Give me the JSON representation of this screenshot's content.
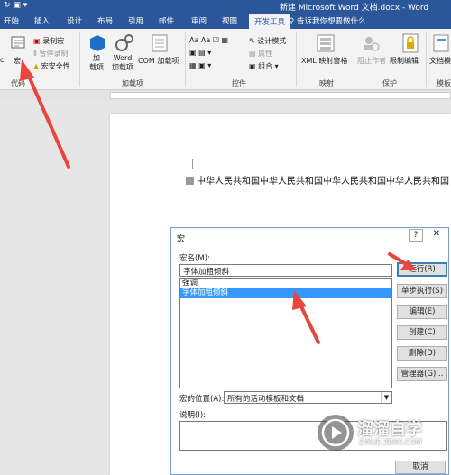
{
  "app": {
    "title": "新建 Microsoft Word 文档.docx - Word",
    "qat": "↻  ▣  ▾"
  },
  "tabs": [
    "开始",
    "插入",
    "设计",
    "布局",
    "引用",
    "邮件",
    "审阅",
    "视图",
    "开发工具"
  ],
  "tell_me": "告诉我你想要做什么",
  "ribbon": {
    "code": {
      "label": "代码",
      "vb_cut": "c",
      "macros": "宏",
      "record_macro": "录制宏",
      "pause_recording": "暂停录制",
      "macro_security": "宏安全性"
    },
    "addins": {
      "label": "加载项",
      "addins": "加\n载项",
      "word_addins": "Word\n加载项",
      "com_addins": "COM 加载项"
    },
    "controls": {
      "label": "控件",
      "design_mode": "设计模式",
      "properties": "属性",
      "group": "组合 ▾"
    },
    "mapping": {
      "label": "映射",
      "xml_pane": "XML 映射窗格"
    },
    "protect": {
      "label": "保护",
      "block_authors": "阻止作者",
      "restrict_editing": "限制编辑"
    },
    "templates": {
      "label": "模板",
      "doc_template": "文档模"
    }
  },
  "document": {
    "text": "中华人民共和国中华人民共和国中华人民共和国中华人民共和国"
  },
  "dialog": {
    "title": "宏",
    "help": "?",
    "close": "✕",
    "name_label": "宏名(M):",
    "name_value": "字体加粗倾斜",
    "macros": [
      {
        "name": "强调",
        "selected": false
      },
      {
        "name": "字体加粗倾斜",
        "selected": true
      }
    ],
    "buttons": {
      "run": "运行(R)",
      "step_into": "单步执行(S)",
      "edit": "编辑(E)",
      "create": "创建(C)",
      "delete": "删除(D)",
      "organizer": "管理器(G)..."
    },
    "location_label": "宏的位置(A):",
    "location_value": "所有的活动模板和文档",
    "description_label": "说明(I):",
    "cancel": "取消"
  },
  "watermark": {
    "brand": "溜溜自学",
    "url": "ZIXUE.3D66.COM"
  },
  "colors": {
    "word_blue": "#2b579a",
    "arrow_red": "#e8453c",
    "selection_blue": "#3399ff"
  }
}
